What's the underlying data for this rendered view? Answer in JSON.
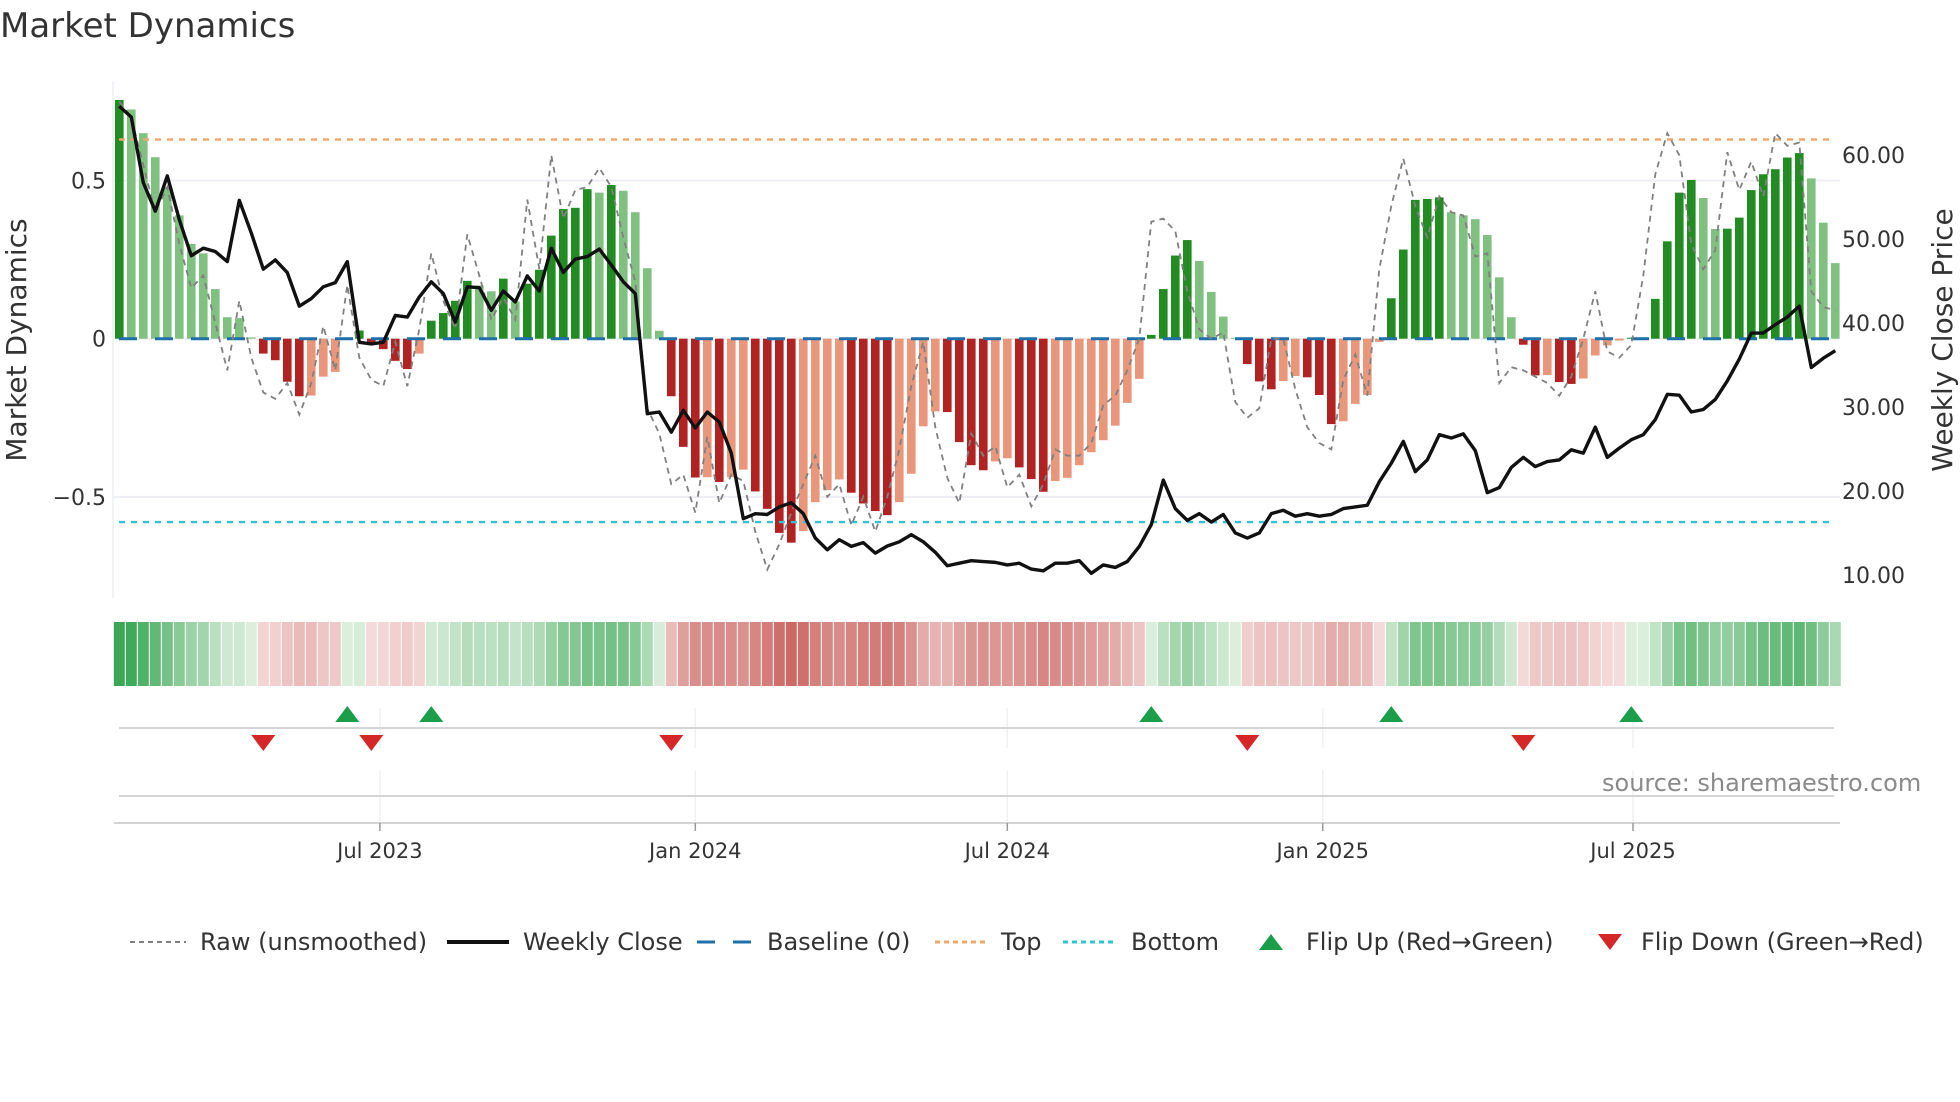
{
  "title": "Market Dynamics",
  "source": "source: sharemaestro.com",
  "colors": {
    "pos_rising": "#228b22",
    "pos_falling": "#80c080",
    "neg_falling": "#b22222",
    "neg_rising": "#e9967a",
    "raw": "#808080",
    "close": "#111111",
    "baseline": "#1f6fa8",
    "top": "#f0a868",
    "bottom": "#2ec4d6",
    "flip_up": "#1a9e4a",
    "flip_down": "#d62728"
  },
  "legend": [
    {
      "key": "raw",
      "label": "Raw (unsmoothed)"
    },
    {
      "key": "close",
      "label": "Weekly Close"
    },
    {
      "key": "baseline",
      "label": "Baseline (0)"
    },
    {
      "key": "top",
      "label": "Top"
    },
    {
      "key": "bottom",
      "label": "Bottom"
    },
    {
      "key": "flip_up",
      "label": "Flip Up (Red→Green)"
    },
    {
      "key": "flip_down",
      "label": "Flip Down (Green→Red)"
    }
  ],
  "chart_data": {
    "type": "bar",
    "title": "Market Dynamics",
    "ylabel": "Market Dynamics",
    "y2label": "Weekly Close Price",
    "ylim": [
      -0.82,
      0.815
    ],
    "y2lim": [
      7.26,
      68.8
    ],
    "yticks": [
      {
        "v": 0.5,
        "label": "0.5"
      },
      {
        "v": 0,
        "label": "0"
      },
      {
        "v": -0.5,
        "label": "−0.5"
      }
    ],
    "y2ticks": [
      {
        "v": 60,
        "label": "60.00"
      },
      {
        "v": 50,
        "label": "50.00"
      },
      {
        "v": 40,
        "label": "40.00"
      },
      {
        "v": 30,
        "label": "30.00"
      },
      {
        "v": 20,
        "label": "20.00"
      },
      {
        "v": 10,
        "label": "10.00"
      }
    ],
    "x_start": "2023-01-30",
    "x_step_days": 7,
    "xticks": [
      {
        "date": "2023-07-01",
        "label": "Jul 2023"
      },
      {
        "date": "2024-01-01",
        "label": "Jan 2024"
      },
      {
        "date": "2024-07-01",
        "label": "Jul 2024"
      },
      {
        "date": "2025-01-01",
        "label": "Jan 2025"
      },
      {
        "date": "2025-07-01",
        "label": "Jul 2025"
      }
    ],
    "top_level": 0.63,
    "bottom_level": -0.58,
    "baseline": 0,
    "smoothed": [
      0.755,
      0.725,
      0.65,
      0.574,
      0.48,
      0.39,
      0.3,
      0.27,
      0.157,
      0.068,
      0.065,
      0.004,
      -0.047,
      -0.068,
      -0.136,
      -0.182,
      -0.18,
      -0.12,
      -0.105,
      0.004,
      0.026,
      -0.014,
      -0.033,
      -0.07,
      -0.096,
      -0.047,
      0.057,
      0.081,
      0.12,
      0.183,
      0.168,
      0.15,
      0.19,
      0.118,
      0.174,
      0.218,
      0.326,
      0.41,
      0.414,
      0.473,
      0.462,
      0.486,
      0.468,
      0.4,
      0.223,
      0.025,
      -0.182,
      -0.342,
      -0.439,
      -0.438,
      -0.453,
      -0.438,
      -0.414,
      -0.483,
      -0.538,
      -0.614,
      -0.645,
      -0.608,
      -0.517,
      -0.479,
      -0.445,
      -0.487,
      -0.521,
      -0.545,
      -0.558,
      -0.517,
      -0.427,
      -0.277,
      -0.23,
      -0.232,
      -0.327,
      -0.4,
      -0.416,
      -0.388,
      -0.378,
      -0.407,
      -0.444,
      -0.484,
      -0.45,
      -0.44,
      -0.4,
      -0.359,
      -0.321,
      -0.275,
      -0.203,
      -0.127,
      0.012,
      0.157,
      0.263,
      0.312,
      0.246,
      0.148,
      0.07,
      0.003,
      -0.08,
      -0.135,
      -0.16,
      -0.134,
      -0.118,
      -0.122,
      -0.178,
      -0.27,
      -0.261,
      -0.206,
      -0.178,
      -0.01,
      0.128,
      0.282,
      0.439,
      0.442,
      0.447,
      0.4,
      0.39,
      0.378,
      0.328,
      0.194,
      0.068,
      -0.019,
      -0.116,
      -0.115,
      -0.137,
      -0.143,
      -0.126,
      -0.053,
      -0.021,
      -0.006,
      0.003,
      0.004,
      0.126,
      0.308,
      0.462,
      0.502,
      0.445,
      0.347,
      0.348,
      0.383,
      0.47,
      0.52,
      0.536,
      0.573,
      0.587,
      0.507,
      0.367,
      0.239
    ],
    "raw": [
      0.75,
      0.7,
      0.55,
      0.4,
      0.48,
      0.3,
      0.16,
      0.2,
      0.05,
      -0.1,
      0.12,
      -0.06,
      -0.17,
      -0.19,
      -0.14,
      -0.24,
      -0.14,
      0.04,
      -0.1,
      0.17,
      -0.06,
      -0.13,
      -0.15,
      -0.01,
      -0.15,
      0.03,
      0.27,
      0.12,
      0.03,
      0.33,
      0.2,
      0.06,
      0.13,
      0.06,
      0.44,
      0.22,
      0.58,
      0.38,
      0.47,
      0.48,
      0.54,
      0.48,
      0.32,
      0.18,
      -0.22,
      -0.3,
      -0.46,
      -0.43,
      -0.55,
      -0.31,
      -0.52,
      -0.43,
      -0.45,
      -0.61,
      -0.73,
      -0.65,
      -0.55,
      -0.46,
      -0.37,
      -0.5,
      -0.46,
      -0.59,
      -0.5,
      -0.61,
      -0.5,
      -0.35,
      -0.15,
      -0.01,
      -0.28,
      -0.44,
      -0.52,
      -0.3,
      -0.37,
      -0.34,
      -0.47,
      -0.43,
      -0.53,
      -0.46,
      -0.35,
      -0.37,
      -0.37,
      -0.33,
      -0.21,
      -0.18,
      -0.1,
      0.0,
      0.37,
      0.38,
      0.34,
      0.15,
      0.03,
      0.0,
      0.02,
      -0.2,
      -0.25,
      -0.22,
      0.0,
      0.0,
      -0.16,
      -0.28,
      -0.33,
      -0.35,
      -0.13,
      -0.05,
      -0.18,
      0.22,
      0.42,
      0.57,
      0.42,
      0.32,
      0.45,
      0.4,
      0.39,
      0.26,
      0.27,
      -0.14,
      -0.09,
      -0.1,
      -0.12,
      -0.14,
      -0.18,
      -0.12,
      0.0,
      0.15,
      -0.04,
      -0.06,
      -0.02,
      0.2,
      0.52,
      0.65,
      0.58,
      0.3,
      0.22,
      0.28,
      0.59,
      0.47,
      0.56,
      0.45,
      0.65,
      0.61,
      0.62,
      0.15,
      0.1,
      0.09
    ],
    "close": [
      65.8,
      64.5,
      56.7,
      53.3,
      57.5,
      52.3,
      48.0,
      48.9,
      48.5,
      47.3,
      54.6,
      50.7,
      46.4,
      47.5,
      46.0,
      42.0,
      42.9,
      44.3,
      44.8,
      47.3,
      37.7,
      37.5,
      37.7,
      40.9,
      40.7,
      43.1,
      44.9,
      43.5,
      40.1,
      44.3,
      44.2,
      41.5,
      43.8,
      42.5,
      45.6,
      43.8,
      48.9,
      46.0,
      47.6,
      47.9,
      48.8,
      46.9,
      44.9,
      43.5,
      29.2,
      29.4,
      27.0,
      29.6,
      27.5,
      29.4,
      28.2,
      24.5,
      16.7,
      17.3,
      17.2,
      18.1,
      18.6,
      17.3,
      14.4,
      13.0,
      14.2,
      13.4,
      13.85,
      12.6,
      13.45,
      13.95,
      14.8,
      13.95,
      12.7,
      11.1,
      11.4,
      11.7,
      11.6,
      11.5,
      11.2,
      11.4,
      10.7,
      10.5,
      11.4,
      11.4,
      11.7,
      10.2,
      11.2,
      10.9,
      11.6,
      13.4,
      16.0,
      21.3,
      17.9,
      16.5,
      17.3,
      16.3,
      17.2,
      15.0,
      14.4,
      15.0,
      17.3,
      17.7,
      17.0,
      17.3,
      17.0,
      17.2,
      17.9,
      18.1,
      18.3,
      21.1,
      23.3,
      25.9,
      22.3,
      23.7,
      26.7,
      26.3,
      26.8,
      24.8,
      19.8,
      20.4,
      22.8,
      24.0,
      22.9,
      23.5,
      23.7,
      24.9,
      24.5,
      27.6,
      24.0,
      25.1,
      26.1,
      26.7,
      28.5,
      31.5,
      31.4,
      29.4,
      29.7,
      30.9,
      33.1,
      35.7,
      38.8,
      38.8,
      39.8,
      40.7,
      42.0,
      34.7,
      35.8,
      36.7
    ],
    "flip_up_idx": [
      19,
      26,
      86,
      106,
      126
    ],
    "flip_down_idx": [
      12,
      21,
      46,
      94,
      117
    ],
    "legend_position": "bottom"
  }
}
